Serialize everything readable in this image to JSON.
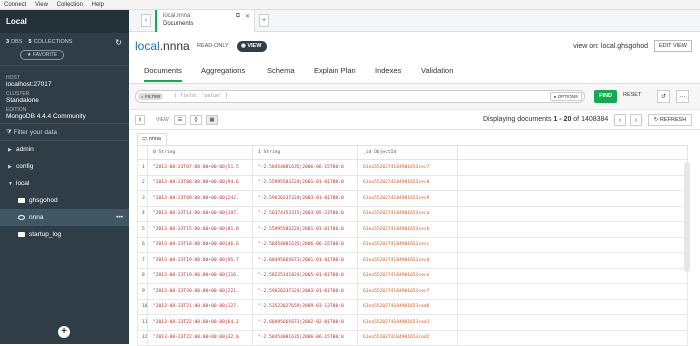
{
  "menu": [
    "Connect",
    "View",
    "Collection",
    "Help"
  ],
  "sidebar": {
    "title": "Local",
    "dbs_count": "3",
    "dbs_label": "DBS",
    "collections_count": "5",
    "collections_label": "COLLECTIONS",
    "favorite": "FAVORITE",
    "host_label": "HOST",
    "host": "localhost:27017",
    "cluster_label": "CLUSTER",
    "cluster": "Standalone",
    "edition_label": "EDITION",
    "edition": "MongoDB 4.4.4 Community",
    "filter_placeholder": "Filter your data",
    "tree": [
      {
        "label": "admin",
        "type": "db"
      },
      {
        "label": "config",
        "type": "db"
      },
      {
        "label": "local",
        "type": "db"
      },
      {
        "label": "ghsgohod",
        "type": "collection"
      },
      {
        "label": "nnna",
        "type": "view"
      },
      {
        "label": "startup_log",
        "type": "collection"
      }
    ]
  },
  "tab": {
    "line1": "local.nnna",
    "line2": "Documents"
  },
  "header": {
    "db": "local",
    "coll": ".nnna",
    "readonly": "READ-ONLY",
    "view_pill": "VIEW",
    "view_on": "view on: local.ghsgohod",
    "edit_view": "EDIT VIEW"
  },
  "subtabs": [
    "Documents",
    "Aggregations",
    "Schema",
    "Explain Plan",
    "Indexes",
    "Validation"
  ],
  "query": {
    "filter_pill": "FILTER",
    "placeholder": "{ field: 'value' }",
    "options": "OPTIONS",
    "find": "FIND",
    "reset": "RESET"
  },
  "toolbar": {
    "view_label": "VIEW",
    "display_prefix": "Displaying documents ",
    "display_range": "1 - 20",
    "display_suffix": " of 1408384",
    "refresh": "REFRESH"
  },
  "grid": {
    "tab": "nnna",
    "columns": [
      "0 String",
      "1 String",
      "_id ObjectId"
    ],
    "rows": [
      {
        "n": "1",
        "c0": "\"2013-08-23T07:00:00+00:00|51.5",
        "c1": "\"-2.58454081635|2006-06-15T00:0",
        "c2": "61ea5520274184901653cec7"
      },
      {
        "n": "2",
        "c0": "\"2013-08-23T08:00:00+00:00|94.6",
        "c1": "\"-2.55995583224|2001-01-01T00:0",
        "c2": "61ea5520274184901653cec8"
      },
      {
        "n": "3",
        "c0": "\"2013-08-23T09:00:00+00:00|242.",
        "c1": "\"-2.59626237324|2003-01-01T00:0",
        "c2": "61ea5520274184901653cec9"
      },
      {
        "n": "4",
        "c0": "\"2013-08-23T14:00:00+00:00|197.",
        "c1": "\"-2.56374153315|2003-05-23T00:0",
        "c2": "61ea5520274184901653ceca"
      },
      {
        "n": "5",
        "c0": "\"2013-08-23T15:00:00+00:00|81.0",
        "c1": "\"-2.55995583224|2001-01-01T00:0",
        "c2": "61ea5520274184901653cecb"
      },
      {
        "n": "6",
        "c0": "\"2013-08-23T18:00:00+00:00|46.6",
        "c1": "\"-2.58454081635|2006-06-15T00:0",
        "c2": "61ea5520274184901653cecc"
      },
      {
        "n": "7",
        "c0": "\"2013-08-23T19:00:00+00:00|95.7",
        "c1": "\"-2.60495665673|2001-01-01T00:0",
        "c2": "61ea5520274184901653cecd"
      },
      {
        "n": "8",
        "c0": "\"2013-08-23T19:00:00+00:00|116.",
        "c1": "\"-2.58225341824|2005-01-01T00:0",
        "c2": "61ea5520274184901653cece"
      },
      {
        "n": "9",
        "c0": "\"2013-08-23T20:00:00+00:00|221.",
        "c1": "\"-2.59626237324|2003-01-01T00:0",
        "c2": "61ea5520274184901653cecf"
      },
      {
        "n": "10",
        "c0": "\"2013-08-23T21:00:00+00:00|127.",
        "c1": "\"-2.53523027659|2009-03-13T00:0",
        "c2": "61ea5520274184901653ced0"
      },
      {
        "n": "11",
        "c0": "\"2013-08-23T22:00:00+00:00|64.2",
        "c1": "\"-2.60495665673|2002-02-01T00:0",
        "c2": "61ea5520274184901653ced1"
      },
      {
        "n": "12",
        "c0": "\"2013-08-23T22:00:00+00:00|32.0",
        "c1": "\"-2.58454081635|2006-06-15T00:0",
        "c2": "61ea5520274184901653ced2"
      }
    ]
  }
}
